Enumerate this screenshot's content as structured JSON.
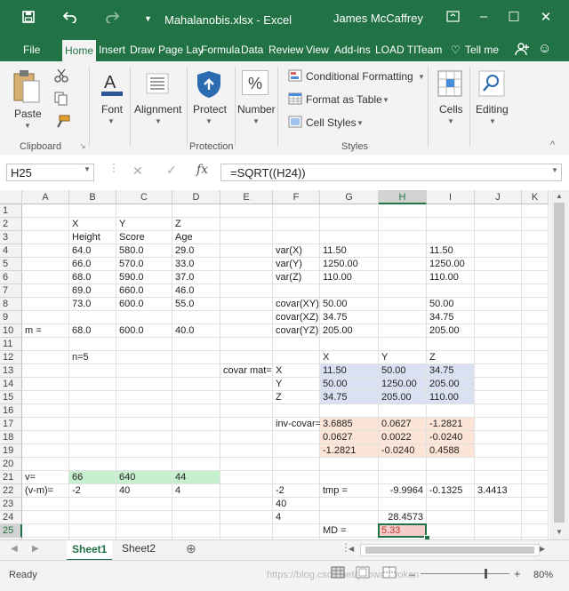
{
  "window": {
    "title": "Mahalanobis.xlsx  -  Excel",
    "user": "James McCaffrey"
  },
  "tabs": [
    {
      "id": "file",
      "label": "File",
      "active": false
    },
    {
      "id": "home",
      "label": "Home",
      "active": true
    },
    {
      "id": "insert",
      "label": "Insert",
      "active": false
    },
    {
      "id": "draw",
      "label": "Draw",
      "active": false
    },
    {
      "id": "pagelayout",
      "label": "Page Lay",
      "active": false
    },
    {
      "id": "formulas",
      "label": "Formula",
      "active": false
    },
    {
      "id": "data",
      "label": "Data",
      "active": false
    },
    {
      "id": "review",
      "label": "Review",
      "active": false
    },
    {
      "id": "view",
      "label": "View",
      "active": false
    },
    {
      "id": "addins",
      "label": "Add-ins",
      "active": false
    },
    {
      "id": "loadtest",
      "label": "LOAD TI",
      "active": false
    },
    {
      "id": "team",
      "label": "Team",
      "active": false
    }
  ],
  "tellme": "Tell me",
  "ribbon": {
    "paste": "Paste",
    "clipboard": "Clipboard",
    "font": "Font",
    "alignment": "Alignment",
    "protect": "Protect",
    "protection": "Protection",
    "number": "Number",
    "number_icon": "%",
    "conditional_formatting": "Conditional Formatting",
    "format_as_table": "Format as Table",
    "cell_styles": "Cell Styles",
    "styles": "Styles",
    "cells": "Cells",
    "editing": "Editing"
  },
  "formula_bar": {
    "name_box": "H25",
    "formula": "=SQRT((H24))",
    "fx": "fx"
  },
  "columns": [
    "A",
    "B",
    "C",
    "D",
    "E",
    "F",
    "G",
    "H",
    "I",
    "J",
    "K"
  ],
  "rows": [
    "1",
    "2",
    "3",
    "4",
    "5",
    "6",
    "7",
    "8",
    "9",
    "10",
    "11",
    "12",
    "13",
    "14",
    "15",
    "16",
    "17",
    "18",
    "19",
    "20",
    "21",
    "22",
    "23",
    "24",
    "25",
    "26"
  ],
  "cells": [
    {
      "ref": "B2",
      "v": "X"
    },
    {
      "ref": "C2",
      "v": "Y"
    },
    {
      "ref": "D2",
      "v": "Z"
    },
    {
      "ref": "B3",
      "v": "Height"
    },
    {
      "ref": "C3",
      "v": "Score"
    },
    {
      "ref": "D3",
      "v": "Age"
    },
    {
      "ref": "B4",
      "v": "64.0"
    },
    {
      "ref": "C4",
      "v": "580.0"
    },
    {
      "ref": "D4",
      "v": "29.0"
    },
    {
      "ref": "F4",
      "v": "var(X)"
    },
    {
      "ref": "G4",
      "v": "11.50"
    },
    {
      "ref": "I4",
      "v": "11.50"
    },
    {
      "ref": "B5",
      "v": "66.0"
    },
    {
      "ref": "C5",
      "v": "570.0"
    },
    {
      "ref": "D5",
      "v": "33.0"
    },
    {
      "ref": "F5",
      "v": "var(Y)"
    },
    {
      "ref": "G5",
      "v": "1250.00"
    },
    {
      "ref": "I5",
      "v": "1250.00"
    },
    {
      "ref": "B6",
      "v": "68.0"
    },
    {
      "ref": "C6",
      "v": "590.0"
    },
    {
      "ref": "D6",
      "v": "37.0"
    },
    {
      "ref": "F6",
      "v": "var(Z)"
    },
    {
      "ref": "G6",
      "v": "110.00"
    },
    {
      "ref": "I6",
      "v": "110.00"
    },
    {
      "ref": "B7",
      "v": "69.0"
    },
    {
      "ref": "C7",
      "v": "660.0"
    },
    {
      "ref": "D7",
      "v": "46.0"
    },
    {
      "ref": "B8",
      "v": "73.0"
    },
    {
      "ref": "C8",
      "v": "600.0"
    },
    {
      "ref": "D8",
      "v": "55.0"
    },
    {
      "ref": "F8",
      "v": "covar(XY)"
    },
    {
      "ref": "G8",
      "v": "50.00"
    },
    {
      "ref": "I8",
      "v": "50.00"
    },
    {
      "ref": "F9",
      "v": "covar(XZ)"
    },
    {
      "ref": "G9",
      "v": "34.75"
    },
    {
      "ref": "I9",
      "v": "34.75"
    },
    {
      "ref": "A10",
      "v": "m ="
    },
    {
      "ref": "B10",
      "v": "68.0"
    },
    {
      "ref": "C10",
      "v": "600.0"
    },
    {
      "ref": "D10",
      "v": "40.0"
    },
    {
      "ref": "F10",
      "v": "covar(YZ)"
    },
    {
      "ref": "G10",
      "v": "205.00"
    },
    {
      "ref": "I10",
      "v": "205.00"
    },
    {
      "ref": "B12",
      "v": "n=5"
    },
    {
      "ref": "G12",
      "v": "X"
    },
    {
      "ref": "H12",
      "v": "Y"
    },
    {
      "ref": "I12",
      "v": "Z"
    },
    {
      "ref": "E13",
      "v": "covar mat="
    },
    {
      "ref": "F13",
      "v": "X"
    },
    {
      "ref": "G13",
      "v": "11.50",
      "fill": "blue"
    },
    {
      "ref": "H13",
      "v": "50.00",
      "fill": "blue"
    },
    {
      "ref": "I13",
      "v": "34.75",
      "fill": "blue"
    },
    {
      "ref": "F14",
      "v": "Y"
    },
    {
      "ref": "G14",
      "v": "50.00",
      "fill": "blue"
    },
    {
      "ref": "H14",
      "v": "1250.00",
      "fill": "blue"
    },
    {
      "ref": "I14",
      "v": "205.00",
      "fill": "blue"
    },
    {
      "ref": "F15",
      "v": "Z"
    },
    {
      "ref": "G15",
      "v": "34.75",
      "fill": "blue"
    },
    {
      "ref": "H15",
      "v": "205.00",
      "fill": "blue"
    },
    {
      "ref": "I15",
      "v": "110.00",
      "fill": "blue"
    },
    {
      "ref": "F17",
      "v": "inv-covar="
    },
    {
      "ref": "G17",
      "v": "3.6885",
      "fill": "peach"
    },
    {
      "ref": "H17",
      "v": "0.0627",
      "fill": "peach"
    },
    {
      "ref": "I17",
      "v": "-1.2821",
      "fill": "peach"
    },
    {
      "ref": "G18",
      "v": "0.0627",
      "fill": "peach"
    },
    {
      "ref": "H18",
      "v": "0.0022",
      "fill": "peach"
    },
    {
      "ref": "I18",
      "v": "-0.0240",
      "fill": "peach"
    },
    {
      "ref": "G19",
      "v": "-1.2821",
      "fill": "peach"
    },
    {
      "ref": "H19",
      "v": "-0.0240",
      "fill": "peach"
    },
    {
      "ref": "I19",
      "v": "0.4588",
      "fill": "peach"
    },
    {
      "ref": "A21",
      "v": "v="
    },
    {
      "ref": "B21",
      "v": "66",
      "fill": "green"
    },
    {
      "ref": "C21",
      "v": "640",
      "fill": "green"
    },
    {
      "ref": "D21",
      "v": "44",
      "fill": "green"
    },
    {
      "ref": "A22",
      "v": "(v-m)="
    },
    {
      "ref": "B22",
      "v": "-2"
    },
    {
      "ref": "C22",
      "v": "40"
    },
    {
      "ref": "D22",
      "v": "4"
    },
    {
      "ref": "F22",
      "v": "-2"
    },
    {
      "ref": "G22",
      "v": "tmp ="
    },
    {
      "ref": "H22",
      "v": "-9.9964",
      "align": "right"
    },
    {
      "ref": "I22",
      "v": "-0.1325"
    },
    {
      "ref": "J22",
      "v": "3.4413"
    },
    {
      "ref": "F23",
      "v": "40"
    },
    {
      "ref": "F24",
      "v": "4"
    },
    {
      "ref": "H24",
      "v": "28.4573",
      "align": "right"
    },
    {
      "ref": "G25",
      "v": "MD ="
    },
    {
      "ref": "H25",
      "v": "5.33",
      "fill": "pink",
      "selected": true
    }
  ],
  "fills": {
    "blue": "#d9e1f2",
    "peach": "#fce4d6",
    "green": "#c6efce",
    "pink": "#f4cccc"
  },
  "accent": "#217346",
  "sheets": [
    {
      "label": "Sheet1",
      "active": true
    },
    {
      "label": "Sheet2",
      "active": false
    }
  ],
  "status": {
    "ready": "Ready",
    "watermark": "https://blog.csdn.net/yaowaowokan",
    "zoom": "80%"
  }
}
